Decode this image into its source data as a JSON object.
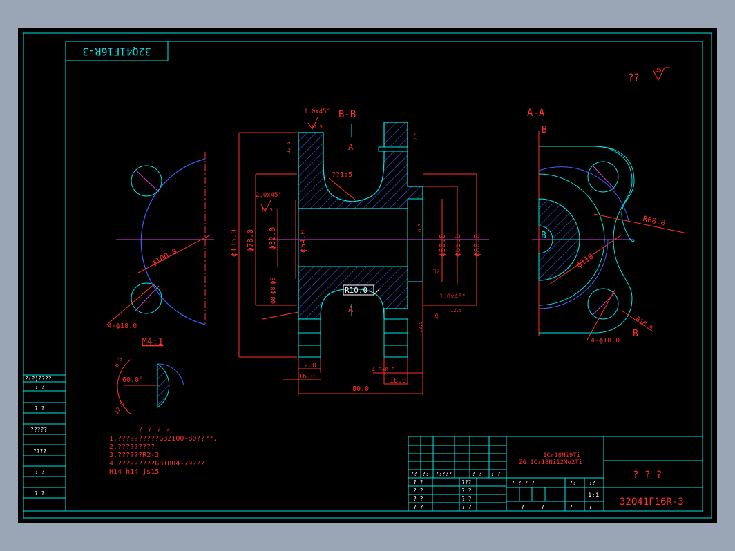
{
  "colors": {
    "background": "#000000",
    "frame": "#00e5e5",
    "text_red": "#ff3030",
    "hatch": "#3a5fff",
    "centerline": "#e040e0",
    "arc_blue": "#4060ff"
  },
  "header": {
    "drawing_no_flipped": "32Q41F16R-3"
  },
  "roughness": {
    "label": "??",
    "value": "25"
  },
  "section_bb": {
    "title": "B-B",
    "cut_mark": "A",
    "cut_mark_bottom": "A",
    "chamfer_top": "1.0x45°",
    "rough_top": "12.5",
    "rough_left": "12.5",
    "rough_right": "12.5",
    "slope": "??1:5",
    "chamfer_left": "2.0x45°",
    "rough_left2": "12.5",
    "d135": "ϕ135.0",
    "d78": "ϕ78.0",
    "d32": "ϕ32.0",
    "d54": "ϕ54.0",
    "d50": "ϕ50.0",
    "d65": "ϕ65.0",
    "d80": "ϕ80.0",
    "r10": "R10.0",
    "chamfer_right": "1.0x45°",
    "rough_right2": "12.5",
    "dim_32": "32",
    "rough_63": "6.3",
    "rough_25": "25",
    "rough_125": "12.5",
    "small_dims": [
      "ϕ8",
      "ϕ8",
      "ϕ8"
    ],
    "dim_2": "2.0",
    "dim_16": "16.0",
    "dim_4": "4.0+0.5",
    "dim_18": "18.0",
    "dim_80": "80.0"
  },
  "left_view": {
    "d100": "ϕ100.0",
    "holes": "4-ϕ18.0"
  },
  "section_aa": {
    "title": "A-A",
    "mark_top": "B",
    "mark_mid": "B",
    "mark_bottom": "B",
    "r60": "R60.0",
    "d110": "ϕ110",
    "r18": "R18.0",
    "holes": "4-ϕ18.0"
  },
  "detail": {
    "title": "M4:1",
    "angle": "60.0°",
    "rough_a": "6.3",
    "rough_b": "12.5"
  },
  "notes": {
    "title": "? ? ? ?",
    "lines": [
      "1.??????????GB2100-80????.",
      "2.?????????.",
      "3.??????R2-3",
      "4.?????????GB1804-79???",
      "  H14  h14  js15"
    ]
  },
  "side_table": {
    "rows": [
      "?(?)????",
      "?  ?",
      "?  ?",
      "?????",
      "????",
      "?  ?",
      "?  ?"
    ]
  },
  "title_block": {
    "material_1": "1Cr18Ni9Ti",
    "material_2": "ZG 1Cr18Ni12Mo2Ti",
    "name": "? ? ?",
    "drawing_no": "32Q41F16R-3",
    "scale": "1:1",
    "header_row": [
      "??",
      "??",
      "?????",
      "? ?",
      "? ?"
    ],
    "left_rows": [
      "? ?",
      "? ?",
      "? ?",
      "? ?"
    ],
    "mid_rows": [
      "???",
      "? ?",
      "? ?",
      "? ?"
    ],
    "bottom_labels": [
      "? ? ? ?",
      "??",
      "??"
    ],
    "last_row": [
      "?",
      "?",
      "?",
      "?"
    ]
  }
}
